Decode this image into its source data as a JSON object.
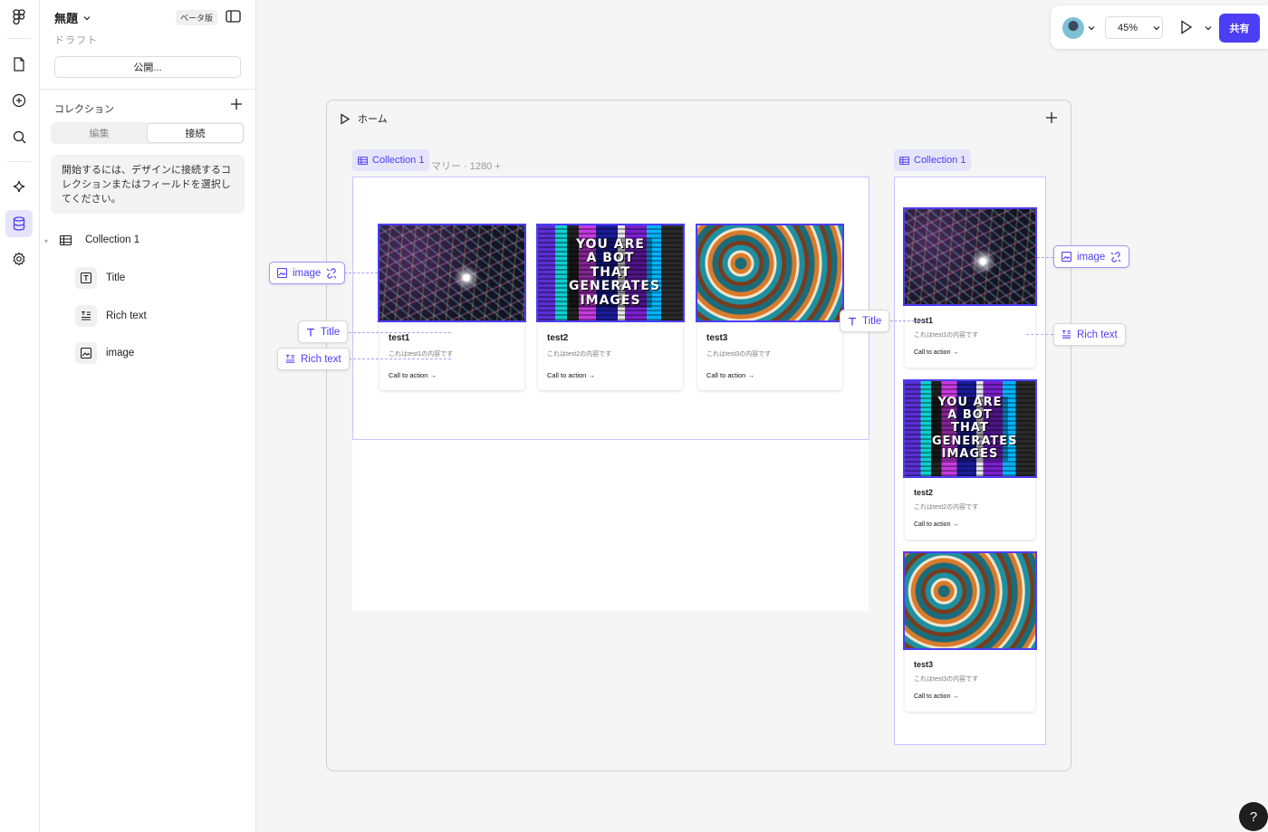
{
  "file": {
    "title": "無題",
    "beta_label": "ベータ版",
    "status": "ドラフト",
    "publish_label": "公開..."
  },
  "collections": {
    "header": "コレクション",
    "tabs": [
      {
        "label": "編集",
        "active": false
      },
      {
        "label": "接続",
        "active": true
      }
    ],
    "info": "開始するには、デザインに接続するコレクションまたはフィールドを選択してください。",
    "tree": {
      "collection": "Collection 1",
      "fields": [
        {
          "label": "Title",
          "icon": "text-field-icon"
        },
        {
          "label": "Rich text",
          "icon": "rich-text-icon"
        },
        {
          "label": "image",
          "icon": "image-field-icon"
        }
      ]
    }
  },
  "topbar": {
    "zoom": "45%",
    "share_label": "共有"
  },
  "canvas": {
    "frame_title": "ホーム",
    "desktop_label": "マリー · 1280 +",
    "collection_chip": "Collection 1",
    "cards": [
      {
        "title": "test1",
        "desc": "これはtest1の内容です",
        "cta": "Call to action →",
        "image": "network"
      },
      {
        "title": "test2",
        "desc": "これはtest2の内容です",
        "cta": "Call to action →",
        "image": "bot"
      },
      {
        "title": "test3",
        "desc": "これはtest3の内容です",
        "cta": "Call to action →",
        "image": "swirl"
      }
    ],
    "bot_image_text": "YOU ARE A BOT THAT GENERATES IMAGES",
    "bindings": {
      "image": "image",
      "title": "Title",
      "rich_text": "Rich text"
    }
  },
  "colors": {
    "accent": "#4c3ef5",
    "accent_light": "#e5e4fb",
    "selection": "#c8c3fb"
  },
  "help_label": "?"
}
